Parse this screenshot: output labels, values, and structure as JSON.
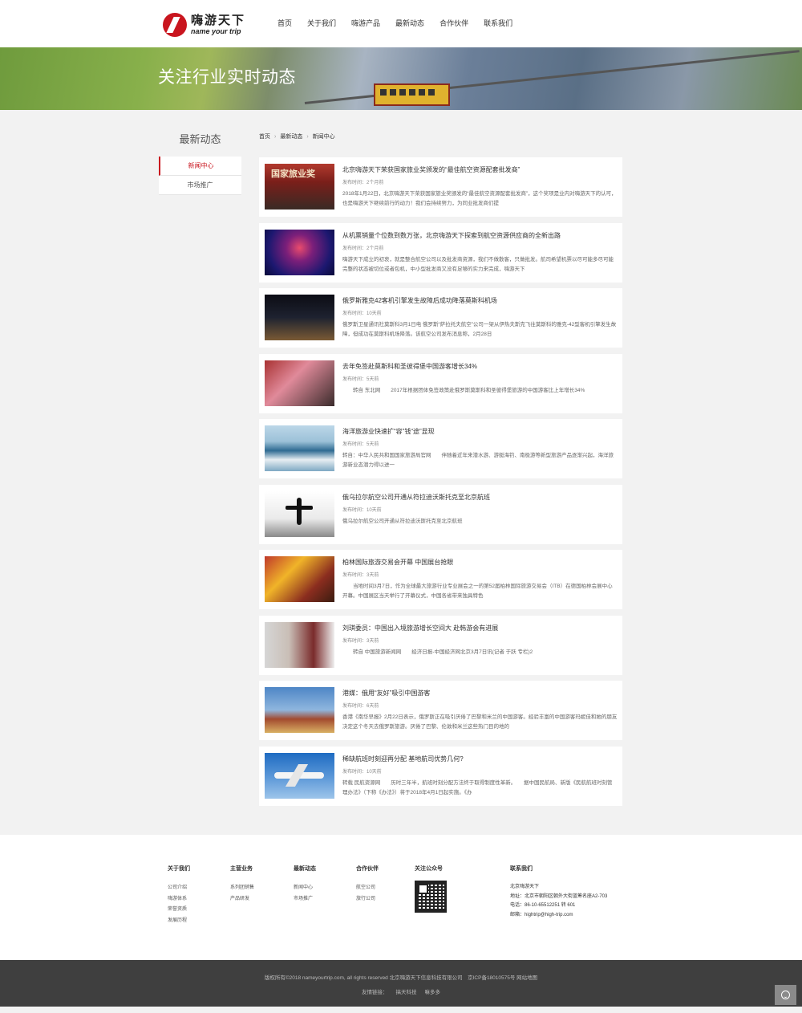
{
  "header": {
    "logo_cn": "嗨游天下",
    "logo_en": "name your trip",
    "nav": [
      "首页",
      "关于我们",
      "嗨游产品",
      "最新动态",
      "合作伙伴",
      "联系我们"
    ]
  },
  "banner": {
    "title": "关注行业实时动态"
  },
  "sidebar": {
    "title": "最新动态",
    "items": [
      {
        "label": "新闻中心",
        "active": true
      },
      {
        "label": "市场推广",
        "active": false
      }
    ]
  },
  "breadcrumb": [
    "首页",
    "最新动态",
    "新闻中心"
  ],
  "news": [
    {
      "title": "北京嗨游天下荣获国家旅业奖颁发的“最佳航空资源配套批发商”",
      "date": "发布时间：2个月前",
      "summary": "2018年1月22日，北京嗨游天下荣获国家旅业奖颁发的“最佳航空资源配套批发商”，这个奖项是业内对嗨游天下的认可，也是嗨游天下继续前行的动力！我们会持续努力，为同业批发商们提"
    },
    {
      "title": "从机票销量个位数到数万张，北京嗨游天下探索到航空资源供应商的全新出路",
      "date": "发布时间：2个月前",
      "summary": "嗨游天下成立的初衷，就是整合航空公司以及批发商资源，我们不做散客，只做批发。航司希望机票以尽可能多尽可能完整的状态被切位或者包机，中小型批发商又没有足够的实力来完成，嗨游天下"
    },
    {
      "title": "俄罗斯雅克42客机引擎发生故障后成功降落莫斯科机场",
      "date": "发布时间：10天前",
      "summary": "俄罗斯卫星通讯社莫斯科3月1日电 俄罗斯“萨拉托夫航空”公司一架从伊热夫斯克飞往莫斯科的雅克-42型客机引擎发生故障，但成功在莫斯科机场降落。该航空公司发布消息称，2月28日"
    },
    {
      "title": "去年免签赴莫斯科和圣彼得堡中国游客增长34%",
      "date": "发布时间：5天前",
      "summary": "　　转自 东北网　　2017年根据团体免签政策赴俄罗斯莫斯科和圣彼得堡旅游的中国游客比上年增长34%"
    },
    {
      "title": "海洋旅游业快速扩“容”钱“途”显现",
      "date": "发布时间：5天前",
      "summary": "转自：中华人民共和国国家旅游局官网　　伴随着近年来潜水游、游艇海钓、南极游等新型旅游产品逐渐兴起，海洋旅游新业态潜力得以进一"
    },
    {
      "title": "俄乌拉尔航空公司开通从符拉迪沃斯托克至北京航班",
      "date": "发布时间：10天前",
      "summary": "俄乌拉尔航空公司开通从符拉迪沃斯托克至北京航班"
    },
    {
      "title": "柏林国际旅游交易会开幕 中国展台抢眼",
      "date": "发布时间：3天前",
      "summary": "　　当地时间3月7日，作为全球最大旅游行业专业展会之一的第52届柏林国际旅游交易会（ITB）在德国柏林会展中心开幕。中国展区当天举行了开幕仪式，中国各省带来独具特色"
    },
    {
      "title": "刘琪委员：中国出入境旅游增长空间大 赴韩游会有进展",
      "date": "发布时间：3天前",
      "summary": "　　转自 中国旅游新闻网　　经济日报-中国经济网北京3月7日讯(记者 于跃 专栏)2"
    },
    {
      "title": "港媒：俄用“友好”吸引中国游客",
      "date": "发布时间：6天前",
      "summary": "香港《南华早报》2月22日表示，俄罗斯正在吸引厌倦了巴黎和米兰的中国游客。经验丰富的中国游客玛妮佳和她的朋友决定这个冬天去俄罗斯旅游。厌倦了巴黎、伦敦和米兰这些热门目的地的"
    },
    {
      "title": "稀缺航班时刻迎再分配 基地航司优势几何?",
      "date": "发布时间：10天前",
      "summary": "转载 民航资源网　　历时三年半，航班时刻分配方法终于取得制度性革新。　　据中国民航局、新版《民航航班时刻管理办法》（下称《办法》）将于2018年4月1日起实施。《办"
    }
  ],
  "footer": {
    "about": {
      "head": "关于我们",
      "links": [
        "公司介绍",
        "嗨游体系",
        "荣誉资质",
        "发展历程"
      ]
    },
    "business": {
      "head": "主营业务",
      "links": [
        "系列团销售",
        "产品研发"
      ]
    },
    "news": {
      "head": "最新动态",
      "links": [
        "新闻中心",
        "市场推广"
      ]
    },
    "partner": {
      "head": "合作伙伴",
      "links": [
        "航空公司",
        "旅行公司"
      ]
    },
    "wechat": {
      "head": "关注公众号"
    },
    "contact": {
      "head": "联系我们",
      "company": "北京嗨游天下",
      "address": "地址：北京市朝阳区朝外大街蓝筹名座A2-703",
      "phone": "电话：86-10-65512251 转 601",
      "email": "邮箱：hightrip@high-trip.com"
    }
  },
  "copyright": {
    "line1": "版权所有©2018 nameyourtrip.com, all rights reserved 北京嗨游天下信息科技有限公司　京ICP备18010575号 网站地图",
    "friends_label": "友情链接：",
    "friends": [
      "搞天科技",
      "嘛多多"
    ]
  }
}
